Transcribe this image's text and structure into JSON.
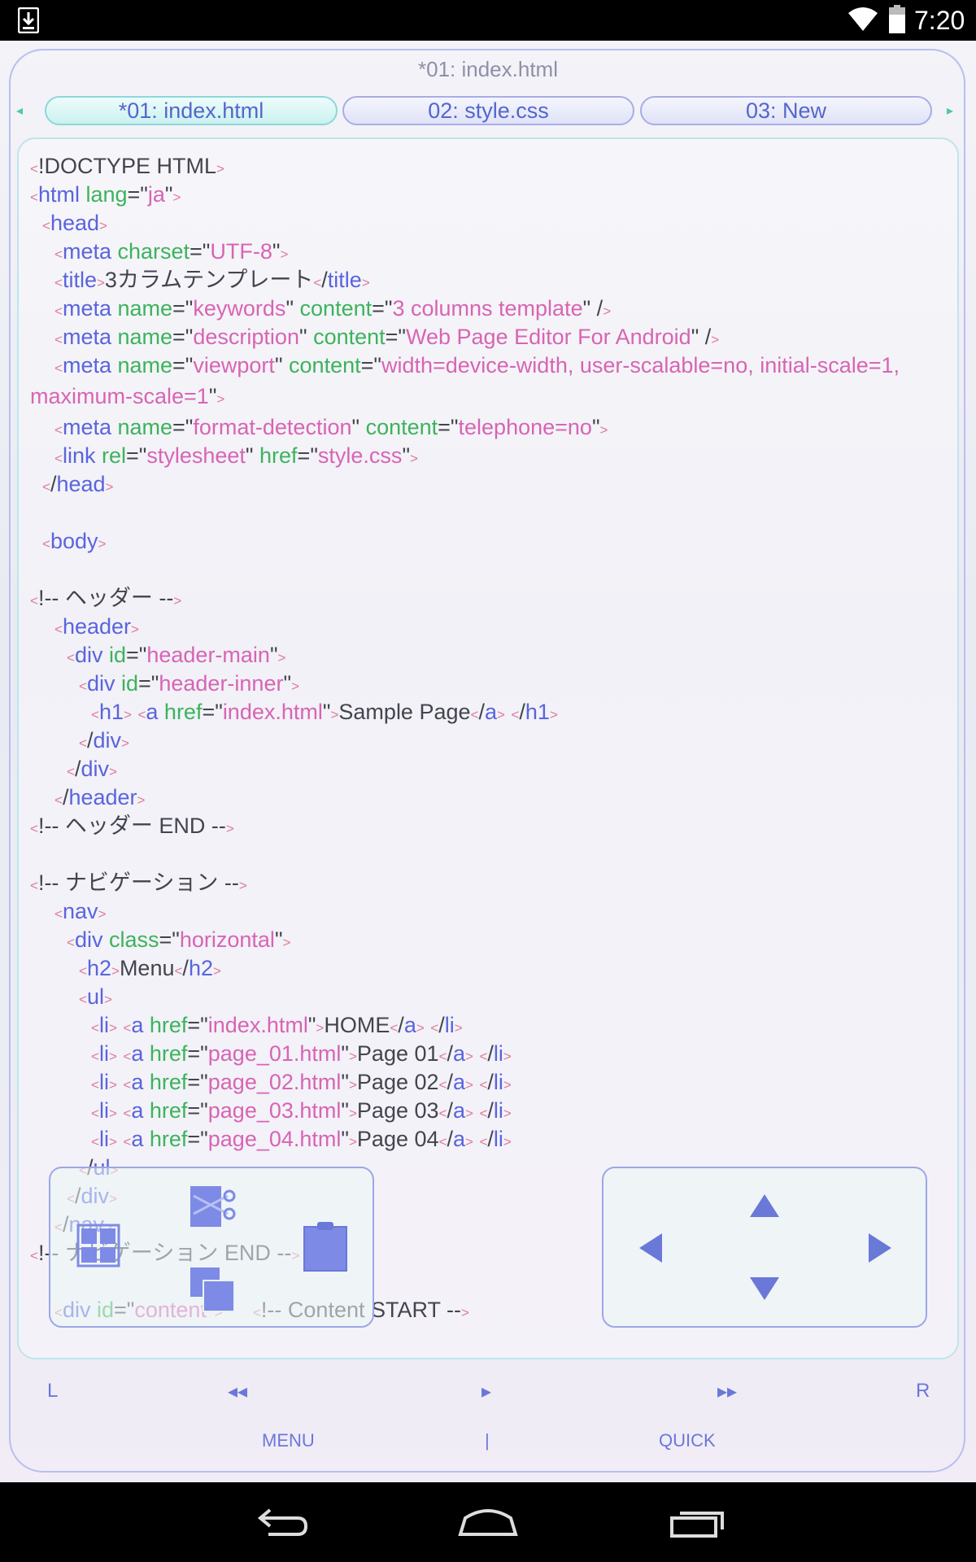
{
  "status_bar": {
    "time": "7:20"
  },
  "window": {
    "title": "*01: index.html"
  },
  "tabs": [
    {
      "label": "*01: index.html"
    },
    {
      "label": "02: style.css"
    },
    {
      "label": "03: New"
    }
  ],
  "code_lines": [
    [
      [
        "b",
        "<"
      ],
      [
        "x",
        "!DOCTYPE HTML"
      ],
      [
        "b",
        ">"
      ]
    ],
    [
      [
        "b",
        "<"
      ],
      [
        "t",
        "html "
      ],
      [
        "a",
        "lang"
      ],
      [
        "x",
        "=\""
      ],
      [
        "v",
        "ja"
      ],
      [
        "x",
        "\""
      ],
      [
        "b",
        ">"
      ]
    ],
    [
      [
        "x",
        "  "
      ],
      [
        "b",
        "<"
      ],
      [
        "t",
        "head"
      ],
      [
        "b",
        ">"
      ]
    ],
    [
      [
        "x",
        "    "
      ],
      [
        "b",
        "<"
      ],
      [
        "t",
        "meta "
      ],
      [
        "a",
        "charset"
      ],
      [
        "x",
        "=\""
      ],
      [
        "v",
        "UTF-8"
      ],
      [
        "x",
        "\""
      ],
      [
        "b",
        ">"
      ]
    ],
    [
      [
        "x",
        "    "
      ],
      [
        "b",
        "<"
      ],
      [
        "t",
        "title"
      ],
      [
        "b",
        ">"
      ],
      [
        "x",
        "3カラムテンプレート"
      ],
      [
        "b",
        "<"
      ],
      [
        "x",
        "/"
      ],
      [
        "t",
        "title"
      ],
      [
        "b",
        ">"
      ]
    ],
    [
      [
        "x",
        "    "
      ],
      [
        "b",
        "<"
      ],
      [
        "t",
        "meta "
      ],
      [
        "a",
        "name"
      ],
      [
        "x",
        "=\""
      ],
      [
        "v",
        "keywords"
      ],
      [
        "x",
        "\" "
      ],
      [
        "a",
        "content"
      ],
      [
        "x",
        "=\""
      ],
      [
        "v",
        "3 columns template"
      ],
      [
        "x",
        "\" /"
      ],
      [
        "b",
        ">"
      ]
    ],
    [
      [
        "x",
        "    "
      ],
      [
        "b",
        "<"
      ],
      [
        "t",
        "meta "
      ],
      [
        "a",
        "name"
      ],
      [
        "x",
        "=\""
      ],
      [
        "v",
        "description"
      ],
      [
        "x",
        "\" "
      ],
      [
        "a",
        "content"
      ],
      [
        "x",
        "=\""
      ],
      [
        "v",
        "Web Page Editor For Android"
      ],
      [
        "x",
        "\" /"
      ],
      [
        "b",
        ">"
      ]
    ],
    [
      [
        "x",
        "    "
      ],
      [
        "b",
        "<"
      ],
      [
        "t",
        "meta "
      ],
      [
        "a",
        "name"
      ],
      [
        "x",
        "=\""
      ],
      [
        "v",
        "viewport"
      ],
      [
        "x",
        "\" "
      ],
      [
        "a",
        "content"
      ],
      [
        "x",
        "=\""
      ],
      [
        "v",
        "width=device-width, user-scalable=no, initial-scale=1, maximum-scale=1"
      ],
      [
        "x",
        "\""
      ],
      [
        "b",
        ">"
      ]
    ],
    [
      [
        "x",
        "    "
      ],
      [
        "b",
        "<"
      ],
      [
        "t",
        "meta "
      ],
      [
        "a",
        "name"
      ],
      [
        "x",
        "=\""
      ],
      [
        "v",
        "format-detection"
      ],
      [
        "x",
        "\" "
      ],
      [
        "a",
        "content"
      ],
      [
        "x",
        "=\""
      ],
      [
        "v",
        "telephone=no"
      ],
      [
        "x",
        "\""
      ],
      [
        "b",
        ">"
      ]
    ],
    [
      [
        "x",
        "    "
      ],
      [
        "b",
        "<"
      ],
      [
        "t",
        "link "
      ],
      [
        "a",
        "rel"
      ],
      [
        "x",
        "=\""
      ],
      [
        "v",
        "stylesheet"
      ],
      [
        "x",
        "\" "
      ],
      [
        "a",
        "href"
      ],
      [
        "x",
        "=\""
      ],
      [
        "v",
        "style.css"
      ],
      [
        "x",
        "\""
      ],
      [
        "b",
        ">"
      ]
    ],
    [
      [
        "x",
        "  "
      ],
      [
        "b",
        "<"
      ],
      [
        "x",
        "/"
      ],
      [
        "t",
        "head"
      ],
      [
        "b",
        ">"
      ]
    ],
    [],
    [
      [
        "x",
        "  "
      ],
      [
        "b",
        "<"
      ],
      [
        "t",
        "body"
      ],
      [
        "b",
        ">"
      ]
    ],
    [],
    [
      [
        "b",
        "<"
      ],
      [
        "cm",
        "!-- ヘッダー --"
      ],
      [
        "b",
        ">"
      ]
    ],
    [
      [
        "x",
        "    "
      ],
      [
        "b",
        "<"
      ],
      [
        "t",
        "header"
      ],
      [
        "b",
        ">"
      ]
    ],
    [
      [
        "x",
        "      "
      ],
      [
        "b",
        "<"
      ],
      [
        "t",
        "div "
      ],
      [
        "a",
        "id"
      ],
      [
        "x",
        "=\""
      ],
      [
        "v",
        "header-main"
      ],
      [
        "x",
        "\""
      ],
      [
        "b",
        ">"
      ]
    ],
    [
      [
        "x",
        "        "
      ],
      [
        "b",
        "<"
      ],
      [
        "t",
        "div "
      ],
      [
        "a",
        "id"
      ],
      [
        "x",
        "=\""
      ],
      [
        "v",
        "header-inner"
      ],
      [
        "x",
        "\""
      ],
      [
        "b",
        ">"
      ]
    ],
    [
      [
        "x",
        "          "
      ],
      [
        "b",
        "<"
      ],
      [
        "t",
        "h1"
      ],
      [
        "b",
        ">"
      ],
      [
        "x",
        " "
      ],
      [
        "b",
        "<"
      ],
      [
        "t",
        "a "
      ],
      [
        "a",
        "href"
      ],
      [
        "x",
        "=\""
      ],
      [
        "v",
        "index.html"
      ],
      [
        "x",
        "\""
      ],
      [
        "b",
        ">"
      ],
      [
        "x",
        "Sample Page"
      ],
      [
        "b",
        "<"
      ],
      [
        "x",
        "/"
      ],
      [
        "t",
        "a"
      ],
      [
        "b",
        ">"
      ],
      [
        "x",
        " "
      ],
      [
        "b",
        "<"
      ],
      [
        "x",
        "/"
      ],
      [
        "t",
        "h1"
      ],
      [
        "b",
        ">"
      ]
    ],
    [
      [
        "x",
        "        "
      ],
      [
        "b",
        "<"
      ],
      [
        "x",
        "/"
      ],
      [
        "t",
        "div"
      ],
      [
        "b",
        ">"
      ]
    ],
    [
      [
        "x",
        "      "
      ],
      [
        "b",
        "<"
      ],
      [
        "x",
        "/"
      ],
      [
        "t",
        "div"
      ],
      [
        "b",
        ">"
      ]
    ],
    [
      [
        "x",
        "    "
      ],
      [
        "b",
        "<"
      ],
      [
        "x",
        "/"
      ],
      [
        "t",
        "header"
      ],
      [
        "b",
        ">"
      ]
    ],
    [
      [
        "b",
        "<"
      ],
      [
        "cm",
        "!-- ヘッダー END --"
      ],
      [
        "b",
        ">"
      ]
    ],
    [],
    [
      [
        "b",
        "<"
      ],
      [
        "cm",
        "!-- ナビゲーション --"
      ],
      [
        "b",
        ">"
      ]
    ],
    [
      [
        "x",
        "    "
      ],
      [
        "b",
        "<"
      ],
      [
        "t",
        "nav"
      ],
      [
        "b",
        ">"
      ]
    ],
    [
      [
        "x",
        "      "
      ],
      [
        "b",
        "<"
      ],
      [
        "t",
        "div "
      ],
      [
        "a",
        "class"
      ],
      [
        "x",
        "=\""
      ],
      [
        "v",
        "horizontal"
      ],
      [
        "x",
        "\""
      ],
      [
        "b",
        ">"
      ]
    ],
    [
      [
        "x",
        "        "
      ],
      [
        "b",
        "<"
      ],
      [
        "t",
        "h2"
      ],
      [
        "b",
        ">"
      ],
      [
        "x",
        "Menu"
      ],
      [
        "b",
        "<"
      ],
      [
        "x",
        "/"
      ],
      [
        "t",
        "h2"
      ],
      [
        "b",
        ">"
      ]
    ],
    [
      [
        "x",
        "        "
      ],
      [
        "b",
        "<"
      ],
      [
        "t",
        "ul"
      ],
      [
        "b",
        ">"
      ]
    ],
    [
      [
        "x",
        "          "
      ],
      [
        "b",
        "<"
      ],
      [
        "t",
        "li"
      ],
      [
        "b",
        ">"
      ],
      [
        "x",
        " "
      ],
      [
        "b",
        "<"
      ],
      [
        "t",
        "a "
      ],
      [
        "a",
        "href"
      ],
      [
        "x",
        "=\""
      ],
      [
        "v",
        "index.html"
      ],
      [
        "x",
        "\""
      ],
      [
        "b",
        ">"
      ],
      [
        "x",
        "HOME"
      ],
      [
        "b",
        "<"
      ],
      [
        "x",
        "/"
      ],
      [
        "t",
        "a"
      ],
      [
        "b",
        ">"
      ],
      [
        "x",
        " "
      ],
      [
        "b",
        "<"
      ],
      [
        "x",
        "/"
      ],
      [
        "t",
        "li"
      ],
      [
        "b",
        ">"
      ]
    ],
    [
      [
        "x",
        "          "
      ],
      [
        "b",
        "<"
      ],
      [
        "t",
        "li"
      ],
      [
        "b",
        ">"
      ],
      [
        "x",
        " "
      ],
      [
        "b",
        "<"
      ],
      [
        "t",
        "a "
      ],
      [
        "a",
        "href"
      ],
      [
        "x",
        "=\""
      ],
      [
        "v",
        "page_01.html"
      ],
      [
        "x",
        "\""
      ],
      [
        "b",
        ">"
      ],
      [
        "x",
        "Page 01"
      ],
      [
        "b",
        "<"
      ],
      [
        "x",
        "/"
      ],
      [
        "t",
        "a"
      ],
      [
        "b",
        ">"
      ],
      [
        "x",
        " "
      ],
      [
        "b",
        "<"
      ],
      [
        "x",
        "/"
      ],
      [
        "t",
        "li"
      ],
      [
        "b",
        ">"
      ]
    ],
    [
      [
        "x",
        "          "
      ],
      [
        "b",
        "<"
      ],
      [
        "t",
        "li"
      ],
      [
        "b",
        ">"
      ],
      [
        "x",
        " "
      ],
      [
        "b",
        "<"
      ],
      [
        "t",
        "a "
      ],
      [
        "a",
        "href"
      ],
      [
        "x",
        "=\""
      ],
      [
        "v",
        "page_02.html"
      ],
      [
        "x",
        "\""
      ],
      [
        "b",
        ">"
      ],
      [
        "x",
        "Page 02"
      ],
      [
        "b",
        "<"
      ],
      [
        "x",
        "/"
      ],
      [
        "t",
        "a"
      ],
      [
        "b",
        ">"
      ],
      [
        "x",
        " "
      ],
      [
        "b",
        "<"
      ],
      [
        "x",
        "/"
      ],
      [
        "t",
        "li"
      ],
      [
        "b",
        ">"
      ]
    ],
    [
      [
        "x",
        "          "
      ],
      [
        "b",
        "<"
      ],
      [
        "t",
        "li"
      ],
      [
        "b",
        ">"
      ],
      [
        "x",
        " "
      ],
      [
        "b",
        "<"
      ],
      [
        "t",
        "a "
      ],
      [
        "a",
        "href"
      ],
      [
        "x",
        "=\""
      ],
      [
        "v",
        "page_03.html"
      ],
      [
        "x",
        "\""
      ],
      [
        "b",
        ">"
      ],
      [
        "x",
        "Page 03"
      ],
      [
        "b",
        "<"
      ],
      [
        "x",
        "/"
      ],
      [
        "t",
        "a"
      ],
      [
        "b",
        ">"
      ],
      [
        "x",
        " "
      ],
      [
        "b",
        "<"
      ],
      [
        "x",
        "/"
      ],
      [
        "t",
        "li"
      ],
      [
        "b",
        ">"
      ]
    ],
    [
      [
        "x",
        "          "
      ],
      [
        "b",
        "<"
      ],
      [
        "t",
        "li"
      ],
      [
        "b",
        ">"
      ],
      [
        "x",
        " "
      ],
      [
        "b",
        "<"
      ],
      [
        "t",
        "a "
      ],
      [
        "a",
        "href"
      ],
      [
        "x",
        "=\""
      ],
      [
        "v",
        "page_04.html"
      ],
      [
        "x",
        "\""
      ],
      [
        "b",
        ">"
      ],
      [
        "x",
        "Page 04"
      ],
      [
        "b",
        "<"
      ],
      [
        "x",
        "/"
      ],
      [
        "t",
        "a"
      ],
      [
        "b",
        ">"
      ],
      [
        "x",
        " "
      ],
      [
        "b",
        "<"
      ],
      [
        "x",
        "/"
      ],
      [
        "t",
        "li"
      ],
      [
        "b",
        ">"
      ]
    ],
    [
      [
        "x",
        "        "
      ],
      [
        "b",
        "<"
      ],
      [
        "x",
        "/"
      ],
      [
        "t",
        "ul"
      ],
      [
        "b",
        ">"
      ]
    ],
    [
      [
        "x",
        "      "
      ],
      [
        "b",
        "<"
      ],
      [
        "x",
        "/"
      ],
      [
        "t",
        "div"
      ],
      [
        "b",
        ">"
      ]
    ],
    [
      [
        "x",
        "    "
      ],
      [
        "b",
        "<"
      ],
      [
        "x",
        "/"
      ],
      [
        "t",
        "nav"
      ],
      [
        "b",
        ">"
      ]
    ],
    [
      [
        "b",
        "<"
      ],
      [
        "cm",
        "!-- ナビゲーション END --"
      ],
      [
        "b",
        ">"
      ]
    ],
    [],
    [
      [
        "x",
        "    "
      ],
      [
        "b",
        "<"
      ],
      [
        "t",
        "div "
      ],
      [
        "a",
        "id"
      ],
      [
        "x",
        "=\""
      ],
      [
        "v",
        "content"
      ],
      [
        "x",
        "\""
      ],
      [
        "b",
        ">"
      ],
      [
        "x",
        "     "
      ],
      [
        "b",
        "<"
      ],
      [
        "cm",
        "!-- Content START --"
      ],
      [
        "b",
        ">"
      ]
    ]
  ],
  "bottom_nav": {
    "left": "L",
    "rewind": "◂◂",
    "play": "▸",
    "forward": "▸▸",
    "right": "R"
  },
  "menu_bar": {
    "menu": "MENU",
    "separator": "|",
    "quick": "QUICK"
  },
  "icons": {
    "accent": "#6a78d8",
    "tool_fill": "#7d8ae6"
  }
}
